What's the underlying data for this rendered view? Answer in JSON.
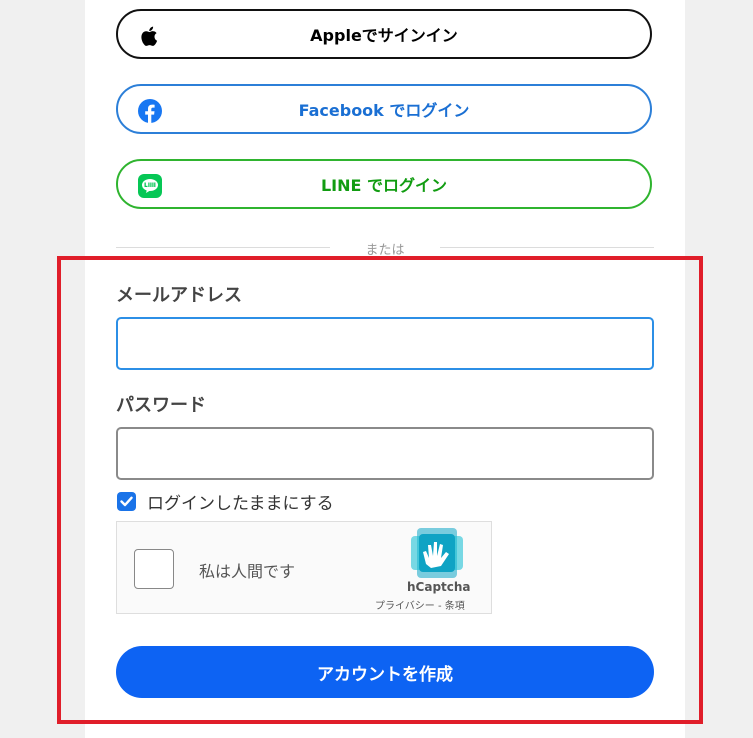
{
  "social": {
    "apple_label": "Appleでサインイン",
    "facebook_label": "Facebook でログイン",
    "line_label": "LINE でログイン"
  },
  "divider_text": "または",
  "form": {
    "email_label": "メールアドレス",
    "email_value": "",
    "password_label": "パスワード",
    "password_value": "",
    "remember_label": "ログインしたままにする",
    "remember_checked": true
  },
  "captcha": {
    "prompt": "私は人間です",
    "brand": "hCaptcha",
    "links": "プライバシー - 条項"
  },
  "submit_label": "アカウントを作成",
  "colors": {
    "facebook": "#1a6fd3",
    "line": "#119c11",
    "primary": "#0d63f3",
    "highlight": "#e01e2a"
  }
}
